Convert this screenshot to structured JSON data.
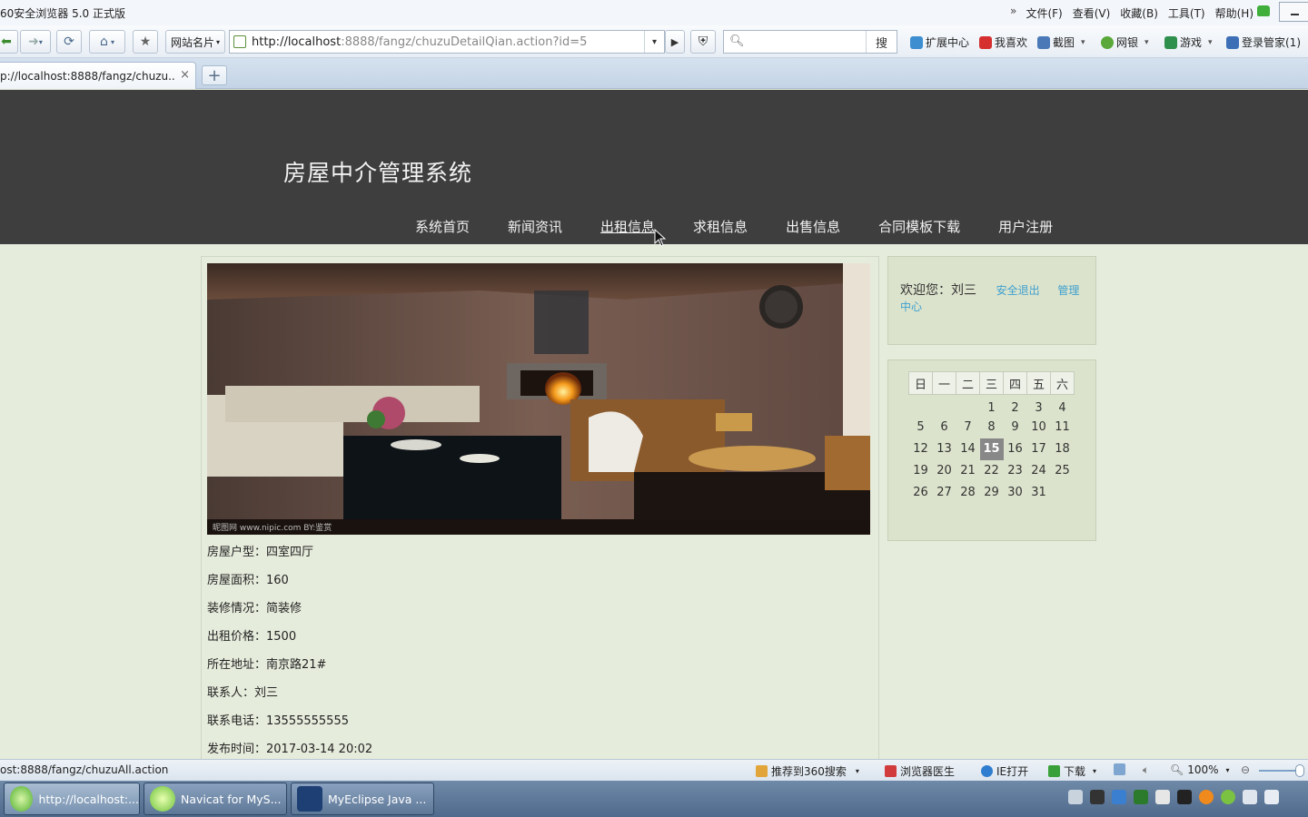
{
  "browser": {
    "app_title": "60安全浏览器 5.0 正式版",
    "menus": [
      "文件(F)",
      "查看(V)",
      "收藏(B)",
      "工具(T)",
      "帮助(H)"
    ],
    "site_dropdown": "网站名片",
    "url_host": "http://localhost",
    "url_rest": ":8888/fangz/chuzuDetailQian.action?id=5",
    "search_button": "搜",
    "extensions": [
      "扩展中心",
      "我喜欢",
      "截图",
      "网银",
      "游戏",
      "登录管家(1)"
    ],
    "tab_title": "p://localhost:8888/fangz/chuzu...",
    "tab_close": "×",
    "new_tab": "+"
  },
  "site": {
    "title": "房屋中介管理系统",
    "nav": [
      "系统首页",
      "新闻资讯",
      "出租信息",
      "求租信息",
      "出售信息",
      "合同模板下载",
      "用户注册"
    ],
    "active_nav_index": 2
  },
  "details": [
    "房屋户型：四室四厅",
    "房屋面积：160",
    "装修情况：简装修",
    "出租价格：1500",
    "所在地址：南京路21#",
    "联系人：刘三",
    "联系电话：13555555555",
    "发布时间：2017-03-14 20:02"
  ],
  "photo": {
    "watermark": "昵图网 www.nipic.com   BY:鉴赏"
  },
  "user_panel": {
    "welcome": "欢迎您：刘三",
    "logout": "安全退出",
    "admin": "管理中心"
  },
  "calendar": {
    "weekdays": [
      "日",
      "一",
      "二",
      "三",
      "四",
      "五",
      "六"
    ],
    "weeks": [
      [
        "",
        "",
        "",
        "1",
        "2",
        "3",
        "4"
      ],
      [
        "5",
        "6",
        "7",
        "8",
        "9",
        "10",
        "11"
      ],
      [
        "12",
        "13",
        "14",
        "15",
        "16",
        "17",
        "18"
      ],
      [
        "19",
        "20",
        "21",
        "22",
        "23",
        "24",
        "25"
      ],
      [
        "26",
        "27",
        "28",
        "29",
        "30",
        "31",
        ""
      ]
    ],
    "today": "15"
  },
  "statusbar": {
    "url": "ost:8888/fangz/chuzuAll.action",
    "recommend": "推荐到360搜索",
    "doctor": "浏览器医生",
    "ie_open": "IE打开",
    "download": "下载",
    "zoom": "100%"
  },
  "taskbar": {
    "items": [
      "http://localhost:...",
      "Navicat for MyS...",
      "MyEclipse Java ..."
    ]
  }
}
